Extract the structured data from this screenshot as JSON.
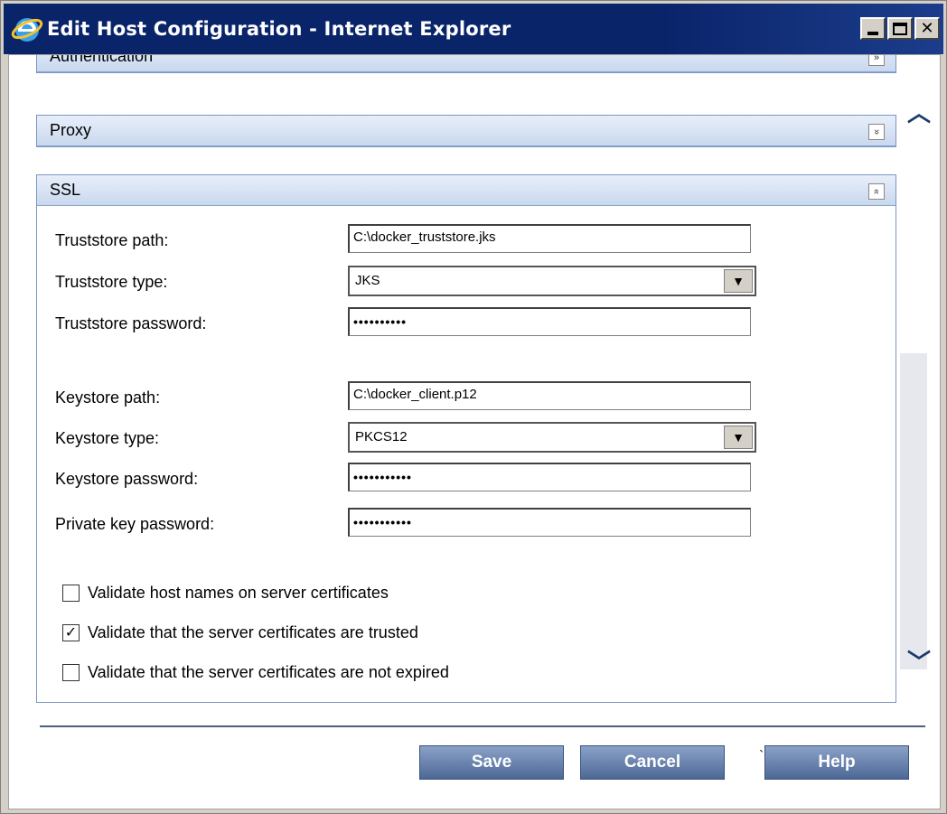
{
  "window": {
    "title": "Edit Host Configuration - Internet Explorer",
    "controls": [
      "minimize",
      "maximize",
      "close"
    ]
  },
  "panels": {
    "authentication": {
      "title": "Authentication",
      "state": "collapsed"
    },
    "proxy": {
      "title": "Proxy",
      "state": "collapsed"
    },
    "ssl": {
      "title": "SSL",
      "state": "expanded"
    }
  },
  "ssl": {
    "truststore_path_label": "Truststore path:",
    "truststore_path_value": "C:\\docker_truststore.jks",
    "truststore_type_label": "Truststore type:",
    "truststore_type_value": "JKS",
    "truststore_password_label": "Truststore password:",
    "truststore_password_value": "••••••••••",
    "keystore_path_label": "Keystore path:",
    "keystore_path_value": "C:\\docker_client.p12",
    "keystore_type_label": "Keystore type:",
    "keystore_type_value": "PKCS12",
    "keystore_password_label": "Keystore password:",
    "keystore_password_value": "•••••••••••",
    "private_key_password_label": "Private key password:",
    "private_key_password_value": "•••••••••••",
    "checks": [
      {
        "label": "Validate host names on server certificates",
        "checked": false
      },
      {
        "label": "Validate that the server certificates are trusted",
        "checked": true
      },
      {
        "label": "Validate that the server certificates are not expired",
        "checked": false
      }
    ]
  },
  "buttons": {
    "save": "Save",
    "cancel": "Cancel",
    "help": "Help"
  },
  "colors": {
    "titlebar": "#0a246a",
    "panel_header": "#c9d8ee",
    "button": "#4e6896"
  }
}
